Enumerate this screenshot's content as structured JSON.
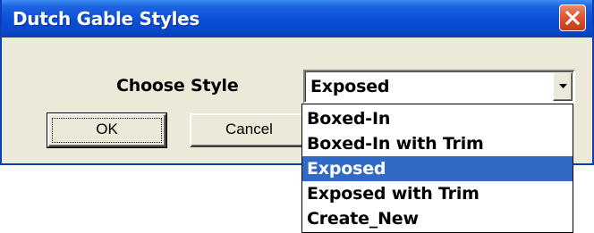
{
  "window": {
    "title": "Dutch Gable Styles",
    "close_icon": "close-icon"
  },
  "form": {
    "label": "Choose Style",
    "combo_value": "Exposed",
    "combo_arrow_icon": "chevron-down-icon"
  },
  "buttons": {
    "ok_label": "OK",
    "cancel_label": "Cancel"
  },
  "dropdown": {
    "items": [
      {
        "label": "Boxed-In",
        "selected": false
      },
      {
        "label": "Boxed-In with Trim",
        "selected": false
      },
      {
        "label": "Exposed",
        "selected": true
      },
      {
        "label": "Exposed with Trim",
        "selected": false
      },
      {
        "label": "Create_New",
        "selected": false
      }
    ]
  },
  "colors": {
    "titlebar": "#0a4fd6",
    "dialog_bg": "#ece9d8",
    "selection": "#316ac5",
    "close_button": "#e0552f"
  }
}
